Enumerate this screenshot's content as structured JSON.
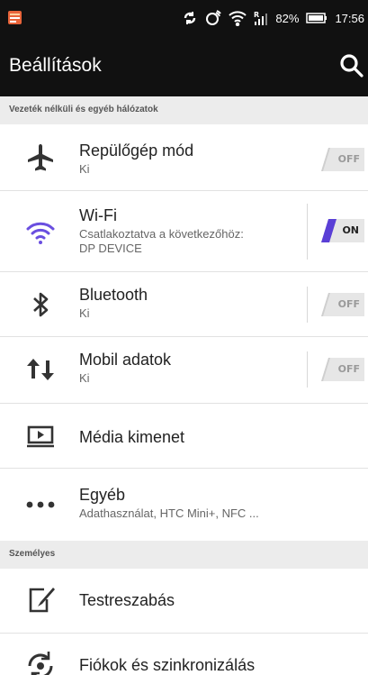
{
  "statusbar": {
    "battery": "82%",
    "time": "17:56"
  },
  "appbar": {
    "title": "Beállítások"
  },
  "sections": {
    "wireless": "Vezeték nélküli és egyéb hálózatok",
    "personal": "Személyes"
  },
  "rows": {
    "airplane": {
      "title": "Repülőgép mód",
      "subtitle": "Ki",
      "toggle": "OFF"
    },
    "wifi": {
      "title": "Wi-Fi",
      "subtitle1": "Csatlakoztatva a következőhöz:",
      "subtitle2": "DP DEVICE",
      "toggle": "ON"
    },
    "bluetooth": {
      "title": "Bluetooth",
      "subtitle": "Ki",
      "toggle": "OFF"
    },
    "mobile": {
      "title": "Mobil adatok",
      "subtitle": "Ki",
      "toggle": "OFF"
    },
    "media": {
      "title": "Média kimenet"
    },
    "other": {
      "title": "Egyéb",
      "subtitle": "Adathasználat, HTC Mini+, NFC ..."
    },
    "customize": {
      "title": "Testreszabás"
    },
    "accounts": {
      "title": "Fiókok és szinkronizálás"
    }
  },
  "colors": {
    "accent": "#5a3fd6",
    "wifi_icon": "#6a4fe0",
    "appbar": "#111111"
  },
  "icons": {
    "status": [
      "notification-icon",
      "sync-icon",
      "nfc-icon",
      "wifi-icon",
      "signal-icon",
      "battery-icon"
    ],
    "search": "search-icon"
  }
}
